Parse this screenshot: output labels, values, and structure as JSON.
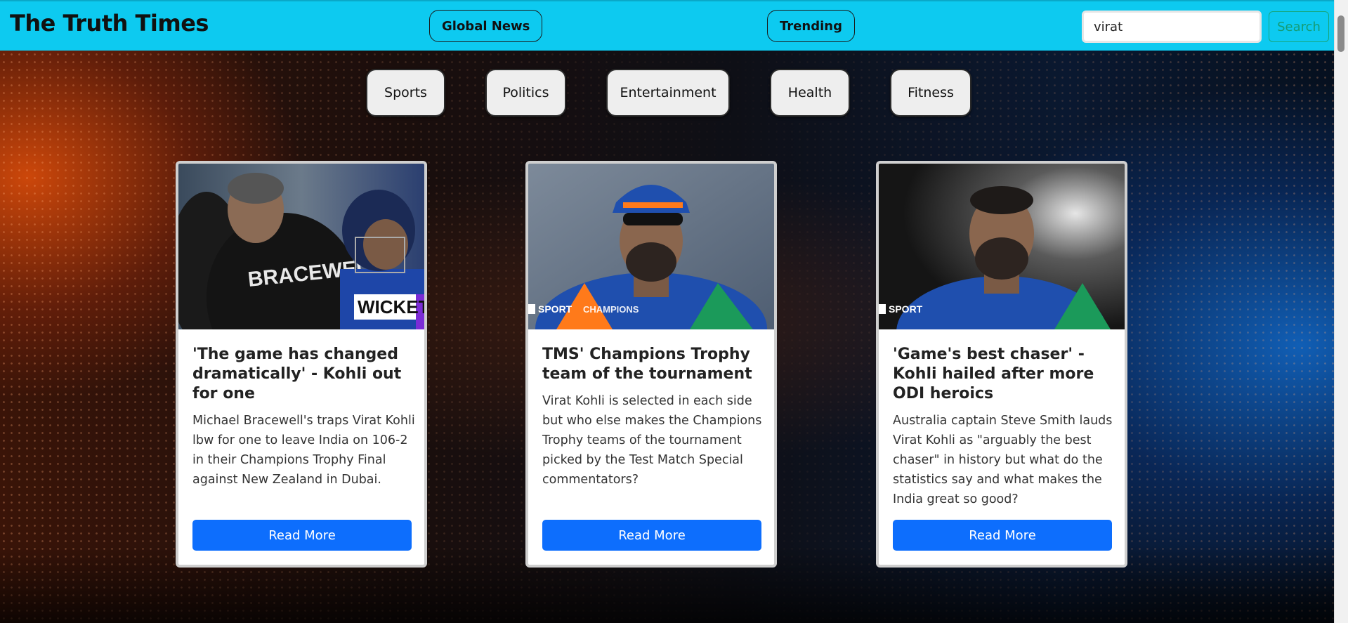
{
  "navbar": {
    "brand": "The Truth Times",
    "links": [
      "Global News",
      "Trending"
    ],
    "search": {
      "value": "virat",
      "button_label": "Search"
    }
  },
  "categories": [
    "Sports",
    "Politics",
    "Entertainment",
    "Health",
    "Fitness"
  ],
  "cards": [
    {
      "title": "'The game has changed dramatically' - Kohli out for one",
      "description": "Michael Bracewell's traps Virat Kohli lbw for one to leave India on 106-2 in their Champions Trophy Final against New Zealand in Dubai.",
      "image_caption": "WICKET",
      "button_label": "Read More"
    },
    {
      "title": "TMS' Champions Trophy team of the tournament",
      "description": "Virat Kohli is selected in each side but who else makes the Champions Trophy teams of the tournament picked by the Test Match Special commentators?",
      "image_caption": "SPORT",
      "button_label": "Read More"
    },
    {
      "title": "'Game's best chaser' - Kohli hailed after more ODI heroics",
      "description": "Australia captain Steve Smith lauds Virat Kohli as \"arguably the best chaser\" in history but what do the statistics say and what makes the India great so good?",
      "image_caption": "SPORT",
      "button_label": "Read More"
    }
  ],
  "colors": {
    "navbar": "#0dcaf0",
    "primary_button": "#0d6efd",
    "search_button": "#159c75"
  }
}
